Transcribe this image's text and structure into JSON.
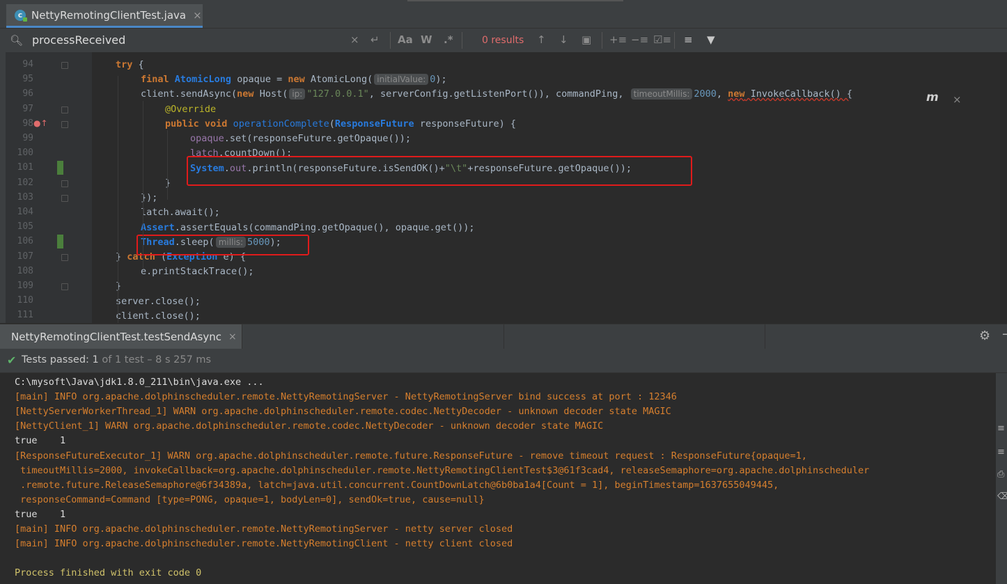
{
  "editor_tab": {
    "label": "NettyRemotingClientTest.java",
    "close": "×",
    "icon": "c"
  },
  "search": {
    "query": "processReceived",
    "results": "0 results",
    "clear": "×",
    "match_case": "Aa",
    "words": "W",
    "regex": ".*"
  },
  "code": {
    "lines": [
      {
        "num": "94",
        "text": "try {"
      },
      {
        "num": "95",
        "text": "final AtomicLong opaque = new AtomicLong(initialValue: 0);"
      },
      {
        "num": "96",
        "text": "client.sendAsync(new Host(ip: \"127.0.0.1\", serverConfig.getListenPort()), commandPing, timeoutMillis: 2000, new InvokeCallback() {"
      },
      {
        "num": "97",
        "text": "@Override"
      },
      {
        "num": "98",
        "text": "public void operationComplete(ResponseFuture responseFuture) {"
      },
      {
        "num": "99",
        "text": "opaque.set(responseFuture.getOpaque());"
      },
      {
        "num": "100",
        "text": "latch.countDown();"
      },
      {
        "num": "101",
        "text": "System.out.println(responseFuture.isSendOK()+\"\\t\"+responseFuture.getOpaque());"
      },
      {
        "num": "102",
        "text": "}"
      },
      {
        "num": "103",
        "text": "});"
      },
      {
        "num": "104",
        "text": "latch.await();"
      },
      {
        "num": "105",
        "text": "Assert.assertEquals(commandPing.getOpaque(), opaque.get());"
      },
      {
        "num": "106",
        "text": "Thread.sleep(millis: 5000);"
      },
      {
        "num": "107",
        "text": "} catch (Exception e) {"
      },
      {
        "num": "108",
        "text": "e.printStackTrace();"
      },
      {
        "num": "109",
        "text": "}"
      },
      {
        "num": "110",
        "text": "server.close();"
      },
      {
        "num": "111",
        "text": "client.close();"
      }
    ],
    "tokens": {
      "try": "try",
      "open_brace": " {",
      "final": "final",
      "AtomicLong": "AtomicLong",
      "opaque_eq": " opaque = ",
      "new": "new",
      "AtomicLong_open": " AtomicLong(",
      "hint_initial": "initialValue:",
      "zero": "0",
      "close_semicolon": ");",
      "client_send": "client.sendAsync(",
      "host": " Host(",
      "hint_ip": "ip:",
      "ip_str": "\"127.0.0.1\"",
      "after_ip": ", serverConfig.getListenPort()), commandPing, ",
      "hint_timeout": "timeoutMillis:",
      "timeout_val": "2000",
      "comma_sp": ", ",
      "invoke": " InvokeCallback() {",
      "override": "@Override",
      "public": "public",
      "void": "void",
      "opComplete": "operationComplete",
      "paren_open": "(",
      "ResponseFuture": "ResponseFuture",
      "rf_param": " responseFuture) {",
      "opaque_field": "opaque",
      "set_call": ".set(responseFuture.getOpaque());",
      "latch_field": "latch",
      "countdown": ".countDown();",
      "System": "System",
      "dot": ".",
      "out": "out",
      "println": ".println(responseFuture.isSendOK()+",
      "tab_str": "\"\\t\"",
      "plus_rest": "+responseFuture.getOpaque());",
      "close_brace": "}",
      "close_paren_brace": "});",
      "latch_await": "latch.await();",
      "Assert": "Assert",
      "assert_rest": ".assertEquals(commandPing.getOpaque(), opaque.get());",
      "Thread": "Thread",
      "sleep_open": ".sleep(",
      "hint_millis": "millis:",
      "sleep_val": "5000",
      "catch_open": "} ",
      "catch": "catch",
      "catch_paren": " (",
      "Exception": "Exception",
      "catch_rest": " e) {",
      "print_trace": "e.printStackTrace();",
      "server_close": "server.close();",
      "client_close": "client.close();",
      "space": " "
    }
  },
  "run_panel": {
    "tab_label": "NettyRemotingClientTest.testSendAsync",
    "tab_close": "×",
    "status_main": "Tests passed: ",
    "status_count": "1",
    "status_rest": " of 1 test – 8 s 257 ms"
  },
  "console": [
    {
      "cls": "c-plain",
      "text": "C:\\mysoft\\Java\\jdk1.8.0_211\\bin\\java.exe ..."
    },
    {
      "cls": "c-err",
      "text": "[main] INFO org.apache.dolphinscheduler.remote.NettyRemotingServer - NettyRemotingServer bind success at port : 12346"
    },
    {
      "cls": "c-err",
      "text": "[NettyServerWorkerThread_1] WARN org.apache.dolphinscheduler.remote.codec.NettyDecoder - unknown decoder state MAGIC"
    },
    {
      "cls": "c-err",
      "text": "[NettyClient_1] WARN org.apache.dolphinscheduler.remote.codec.NettyDecoder - unknown decoder state MAGIC"
    },
    {
      "cls": "c-plain",
      "text": "true    1"
    },
    {
      "cls": "c-err",
      "text": "[ResponseFutureExecutor_1] WARN org.apache.dolphinscheduler.remote.future.ResponseFuture - remove timeout request : ResponseFuture{opaque=1,"
    },
    {
      "cls": "c-err",
      "text": " timeoutMillis=2000, invokeCallback=org.apache.dolphinscheduler.remote.NettyRemotingClientTest$3@61f3cad4, releaseSemaphore=org.apache.dolphinscheduler"
    },
    {
      "cls": "c-err",
      "text": " .remote.future.ReleaseSemaphore@6f34389a, latch=java.util.concurrent.CountDownLatch@6b0ba1a4[Count = 1], beginTimestamp=1637655049445,"
    },
    {
      "cls": "c-err",
      "text": " responseCommand=Command [type=PONG, opaque=1, bodyLen=0], sendOk=true, cause=null}"
    },
    {
      "cls": "c-plain",
      "text": "true    1"
    },
    {
      "cls": "c-err",
      "text": "[main] INFO org.apache.dolphinscheduler.remote.NettyRemotingServer - netty server closed"
    },
    {
      "cls": "c-err",
      "text": "[main] INFO org.apache.dolphinscheduler.remote.NettyRemotingClient - netty client closed"
    },
    {
      "cls": "c-plain",
      "text": ""
    },
    {
      "cls": "c-fin",
      "text": "Process finished with exit code 0"
    }
  ],
  "colors": {
    "keyword": "#cc7832",
    "type": "#287bde",
    "string": "#6a8759",
    "number": "#6897bb",
    "highlight_box": "#e01b1b",
    "passed": "#5fb56b"
  },
  "icons": [
    "search-icon",
    "close-icon",
    "newline-icon",
    "up-arrow-icon",
    "down-arrow-icon",
    "select-all-icon",
    "filter-icon",
    "gear-icon",
    "check-icon",
    "maven-icon"
  ]
}
